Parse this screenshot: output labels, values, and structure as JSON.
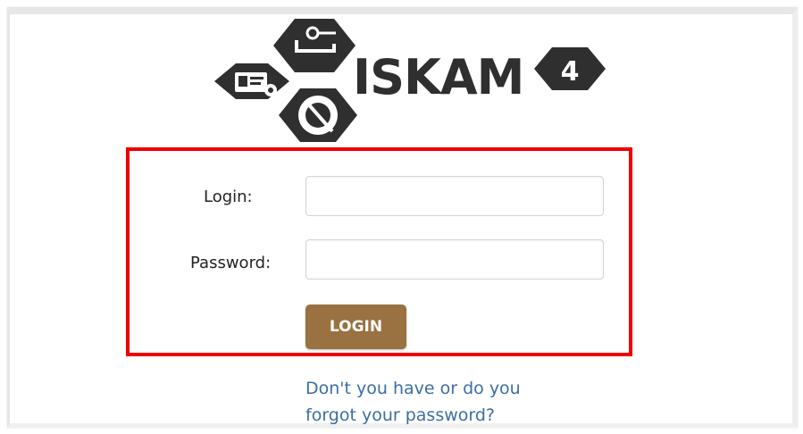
{
  "logo": {
    "text": "ISKAM",
    "version_badge": "4",
    "icons": [
      "id-card-icon",
      "key-bed-icon",
      "plate-cutlery-icon"
    ],
    "hex_color": "#2f2f2f"
  },
  "form": {
    "login_label": "Login:",
    "login_value": "",
    "password_label": "Password:",
    "password_value": "",
    "submit_label": "LOGIN",
    "highlight_color": "#ee0000",
    "button_color": "#9a7140"
  },
  "links": {
    "forgot_password": "Don't you have or do you forgot your password?",
    "link_color": "#3b6ea5"
  }
}
